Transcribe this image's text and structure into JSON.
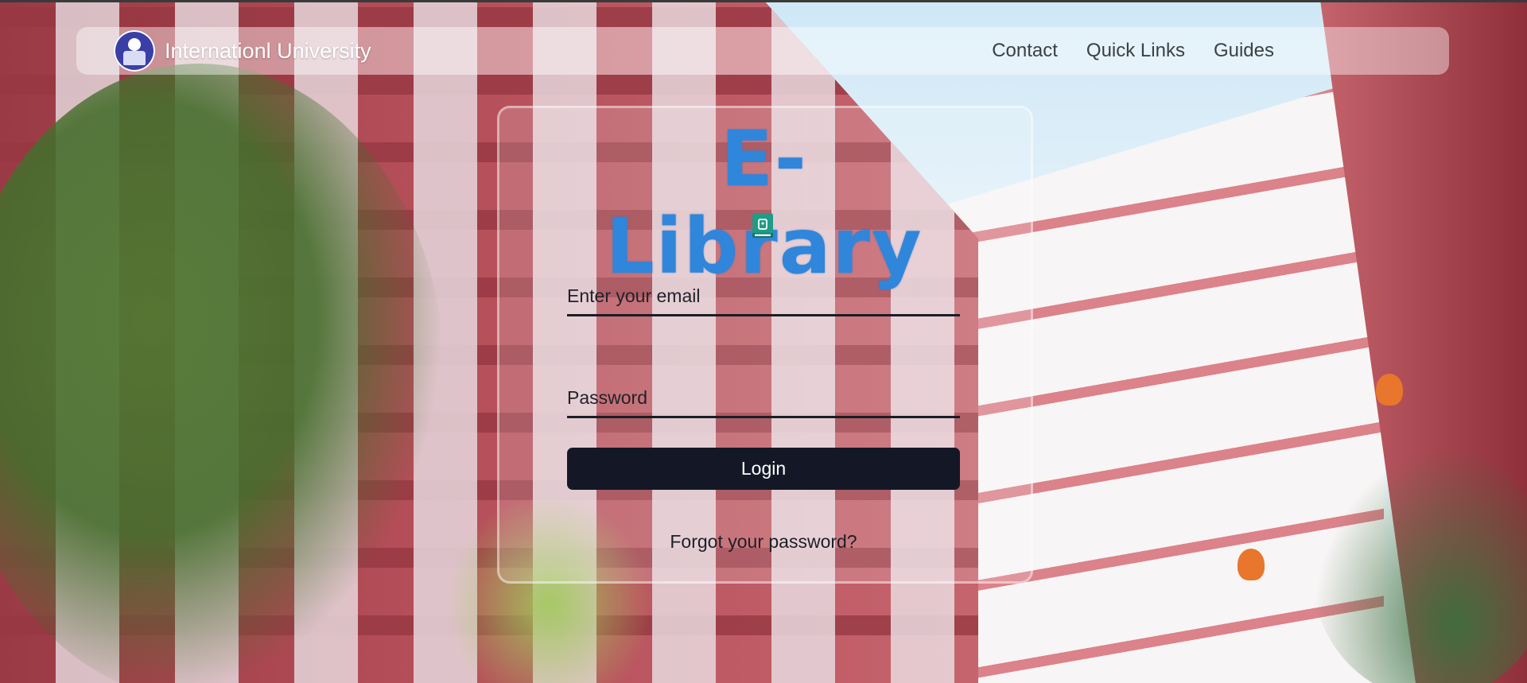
{
  "navbar": {
    "brand_name": "Internationl University",
    "links": [
      {
        "label": "Contact"
      },
      {
        "label": "Quick Links"
      },
      {
        "label": "Guides"
      }
    ]
  },
  "login": {
    "title": "E-Library",
    "title_color": "#2f86da",
    "icon": "book-icon",
    "email_placeholder": "Enter your email",
    "password_placeholder": "Password",
    "login_label": "Login",
    "forgot_label": "Forgot your password?"
  }
}
